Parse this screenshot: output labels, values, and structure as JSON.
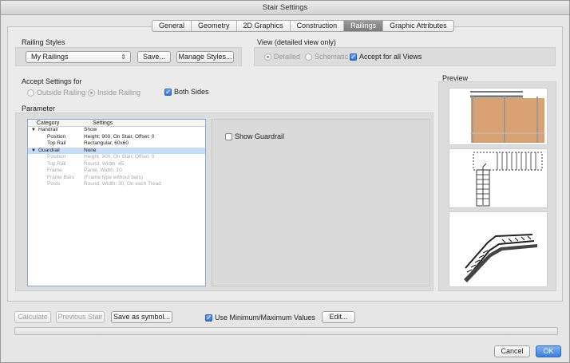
{
  "window": {
    "title": "Stair Settings"
  },
  "tabs": [
    "General",
    "Geometry",
    "2D Graphics",
    "Construction",
    "Railings",
    "Graphic Attributes"
  ],
  "active_tab": "Railings",
  "railing_styles": {
    "label": "Railing Styles",
    "selected": "My Railings",
    "save_label": "Save...",
    "manage_label": "Manage Styles..."
  },
  "view": {
    "label": "View (detailed view only)",
    "detailed": "Detailed",
    "schematic": "Schematic",
    "accept_all": "Accept for all Views"
  },
  "accept_settings": {
    "label": "Accept Settings for",
    "outside": "Outside Railing",
    "inside": "Inside Railing",
    "both": "Both Sides"
  },
  "parameter": {
    "label": "Parameter",
    "col_category": "Category",
    "col_settings": "Settings",
    "rows": [
      {
        "category": "Handrail",
        "settings": "Show",
        "level": 0,
        "expanded": true,
        "dim": false,
        "selected": false
      },
      {
        "category": "Position",
        "settings": "Height: 900, On Stair, Offset: 0",
        "level": 1,
        "dim": false,
        "selected": false
      },
      {
        "category": "Top Rail",
        "settings": "Rectangular, 60x60",
        "level": 1,
        "dim": false,
        "selected": false
      },
      {
        "category": "Guardrail",
        "settings": "None",
        "level": 0,
        "expanded": true,
        "dim": false,
        "selected": true
      },
      {
        "category": "Position",
        "settings": "Height: 900, On Stair, Offset: 0",
        "level": 1,
        "dim": true,
        "selected": false
      },
      {
        "category": "Top Rail",
        "settings": "Round, Width: 45",
        "level": 1,
        "dim": true,
        "selected": false
      },
      {
        "category": "Frame",
        "settings": "Panel, Width: 10",
        "level": 1,
        "dim": true,
        "selected": false
      },
      {
        "category": "Frame Bars",
        "settings": "(Frame type without bars)",
        "level": 1,
        "dim": true,
        "selected": false
      },
      {
        "category": "Posts",
        "settings": "Round, Width: 30, On each Tread",
        "level": 1,
        "dim": true,
        "selected": false
      }
    ],
    "show_guardrail": "Show Guardrail"
  },
  "preview": {
    "label": "Preview"
  },
  "bottom": {
    "calculate": "Calculate",
    "previous_stair": "Previous Stair",
    "save_symbol": "Save as symbol...",
    "use_minmax": "Use Minimum/Maximum Values",
    "edit": "Edit...",
    "cancel": "Cancel",
    "ok": "OK"
  },
  "colors": {
    "accent": "#3a7fde",
    "railing_panel": "#d9a273",
    "selection": "#c7dcf6"
  }
}
